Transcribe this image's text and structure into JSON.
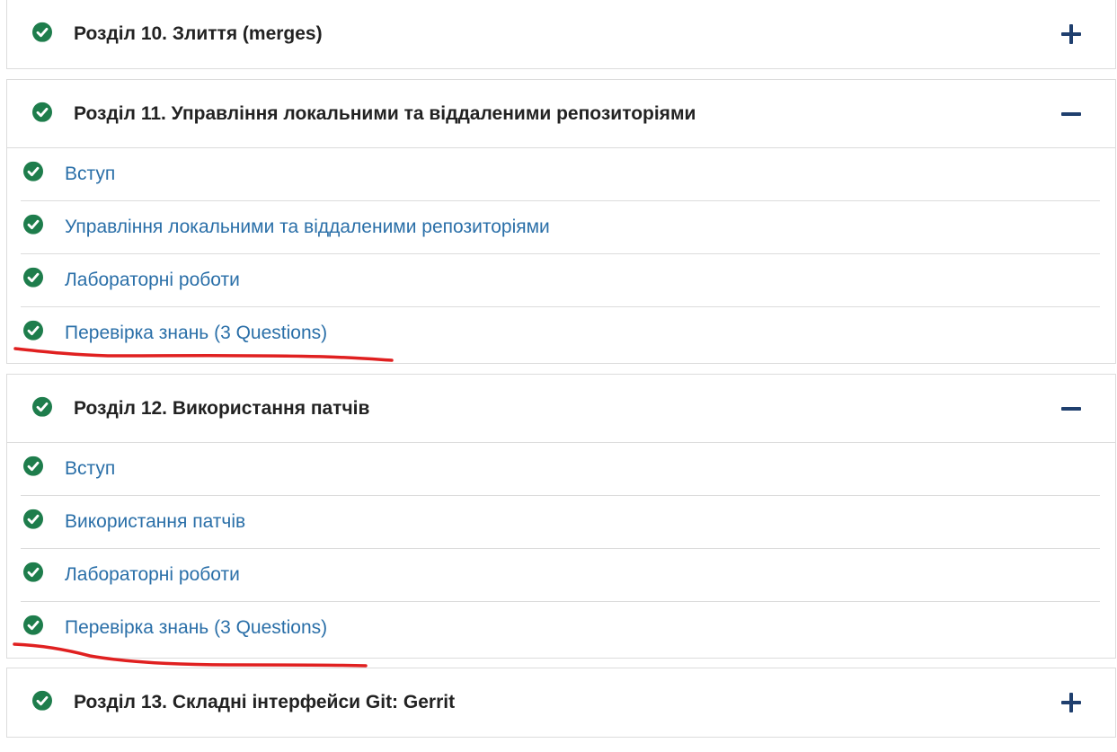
{
  "sections": [
    {
      "title": "Розділ 10. Злиття (merges)",
      "expanded": false,
      "items": []
    },
    {
      "title": "Розділ 11. Управління локальними та віддаленими репозиторіями",
      "expanded": true,
      "items": [
        {
          "label": "Вступ"
        },
        {
          "label": "Управління локальними та віддаленими репозиторіями"
        },
        {
          "label": "Лабораторні роботи"
        },
        {
          "label": "Перевірка знань (3 Questions)"
        }
      ]
    },
    {
      "title": "Розділ 12. Використання патчів",
      "expanded": true,
      "items": [
        {
          "label": "Вступ"
        },
        {
          "label": "Використання патчів"
        },
        {
          "label": "Лабораторні роботи"
        },
        {
          "label": "Перевірка знань (3 Questions)"
        }
      ]
    },
    {
      "title": "Розділ 13. Складні інтерфейси Git: Gerrit",
      "expanded": false,
      "items": []
    }
  ],
  "colors": {
    "check": "#1e7d4c",
    "link": "#2a6fa8",
    "toggle": "#1f3f6e",
    "annotation": "#e02020"
  },
  "icons": {
    "complete": "check-circle-icon",
    "expand": "plus-icon",
    "collapse": "minus-icon"
  }
}
